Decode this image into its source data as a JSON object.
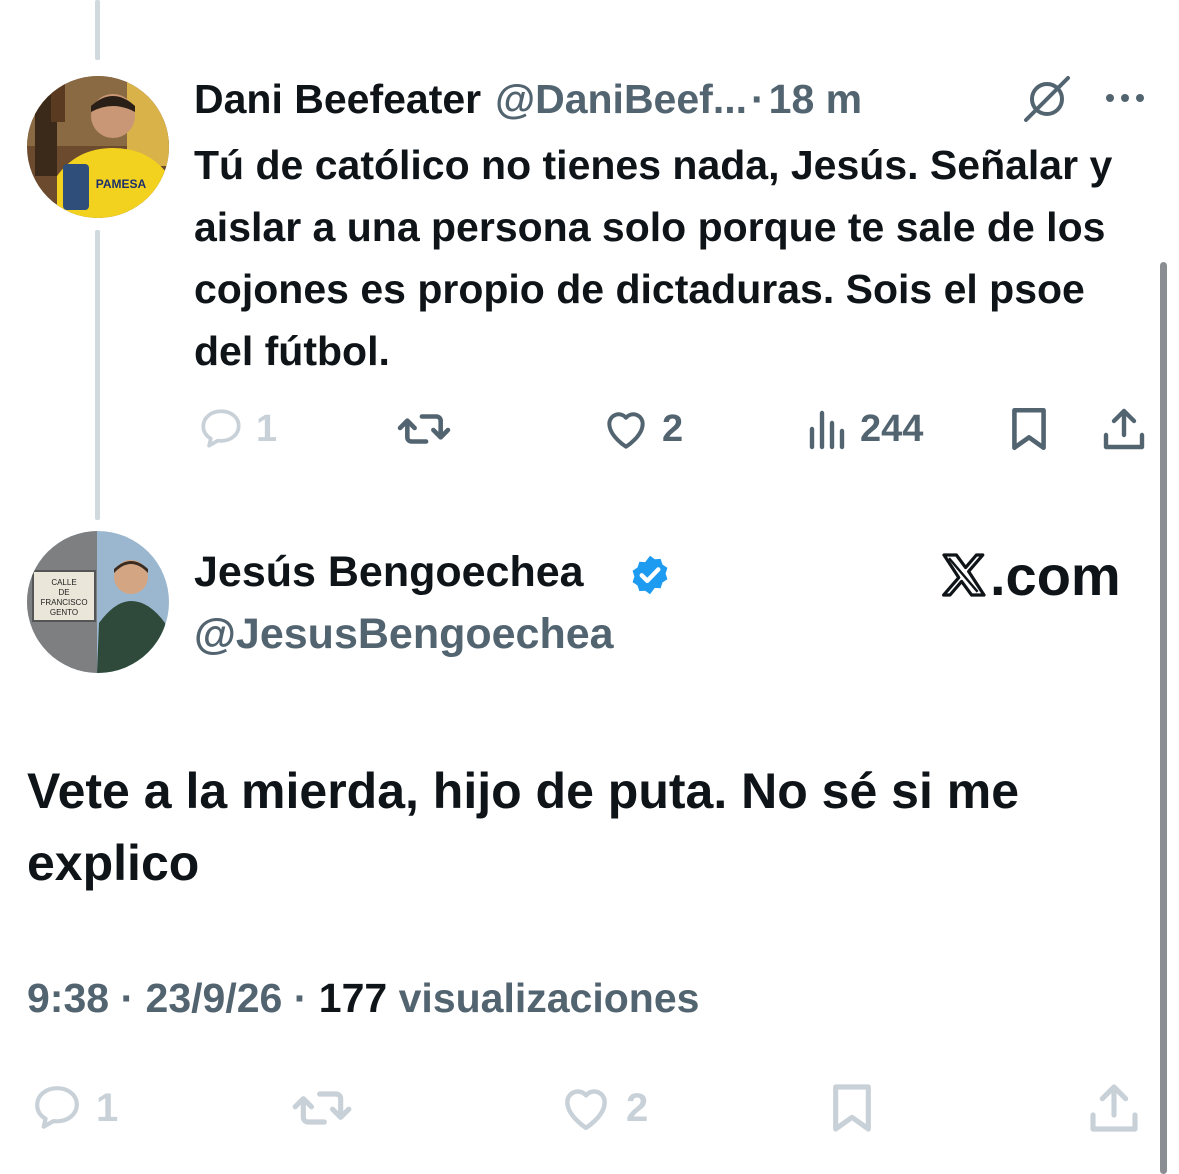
{
  "reply": {
    "name": "Dani Beefeater",
    "handle": "@DaniBeef...",
    "separator": "·",
    "time": "18 m",
    "text": "Tú de católico no tienes nada, Jesús. Señalar y aislar a una persona solo porque te sale de los cojones es propio de dictaduras. Sois el psoe del fútbol.",
    "actions": {
      "replies": "1",
      "likes": "2",
      "views": "244"
    },
    "avatar_text": "PAMESA"
  },
  "main": {
    "name": "Jesús Bengoechea",
    "handle": "@JesusBengoechea",
    "watermark": ".com",
    "text": "Vete a la mierda, hijo de puta. No sé si me explico",
    "time": "9:38",
    "date": "23/9/26",
    "separator": "·",
    "views": "177",
    "views_label": "visualizaciones",
    "actions": {
      "replies": "1",
      "likes": "2"
    },
    "avatar_sign": [
      "CALLE",
      "DE",
      "FRANCISCO",
      "GENTO"
    ]
  },
  "colors": {
    "text": "#0f1419",
    "secondary": "#536471",
    "verified": "#1d9bf0",
    "faded": "#c9d1d8"
  }
}
